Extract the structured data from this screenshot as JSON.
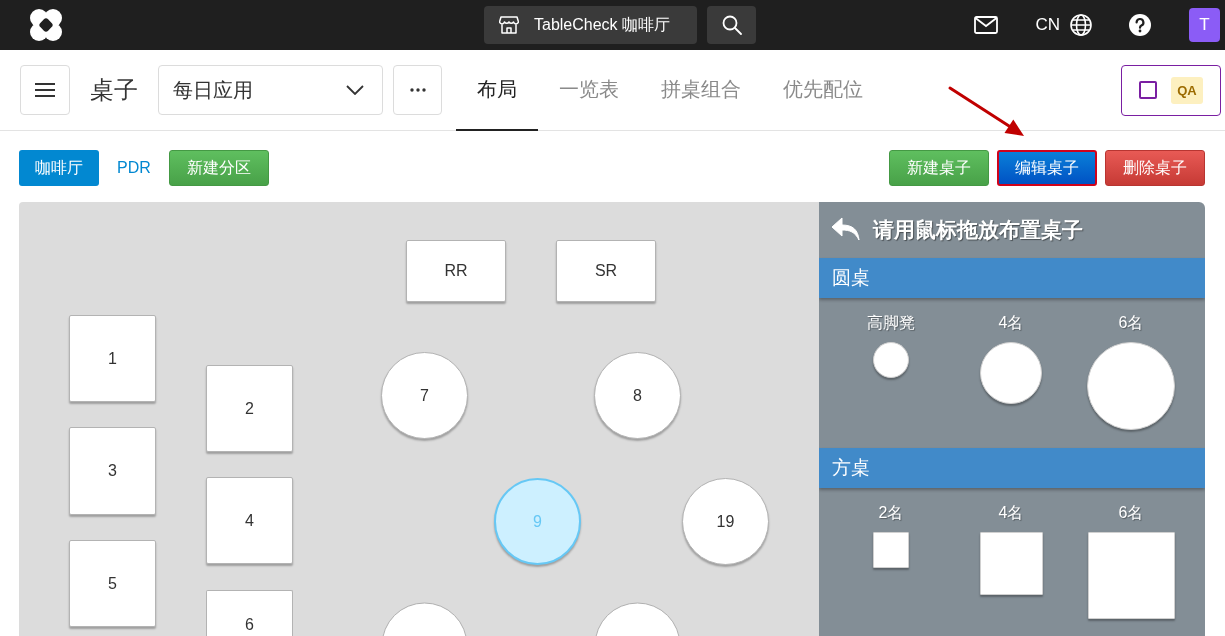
{
  "top_bar": {
    "store_button": "TableCheck 咖啡厅",
    "language": "CN",
    "avatar": "T"
  },
  "header": {
    "title": "桌子",
    "view_select": "每日应用",
    "tabs": [
      {
        "label": "布局",
        "selected": true
      },
      {
        "label": "一览表",
        "selected": false
      },
      {
        "label": "拼桌组合",
        "selected": false
      },
      {
        "label": "优先配位",
        "selected": false
      }
    ],
    "qa_toggle": {
      "label": "QA",
      "checked": false
    }
  },
  "toolbar": {
    "areas": [
      {
        "label": "咖啡厅",
        "selected": true
      },
      {
        "label": "PDR",
        "selected": false
      }
    ],
    "new_area_button": "新建分区",
    "actions": [
      {
        "kind": "new",
        "label": "新建桌子",
        "highlighted": false
      },
      {
        "kind": "edit",
        "label": "编辑桌子",
        "highlighted": true
      },
      {
        "kind": "delete",
        "label": "删除桌子",
        "highlighted": false
      }
    ]
  },
  "floor": {
    "tables": [
      {
        "label": "RR",
        "kind": "rect",
        "selected": false
      },
      {
        "label": "SR",
        "kind": "rect",
        "selected": false
      },
      {
        "label": "1",
        "kind": "square",
        "selected": false
      },
      {
        "label": "2",
        "kind": "square",
        "selected": false
      },
      {
        "label": "3",
        "kind": "square",
        "selected": false
      },
      {
        "label": "4",
        "kind": "square",
        "selected": false
      },
      {
        "label": "5",
        "kind": "square",
        "selected": false
      },
      {
        "label": "6",
        "kind": "square",
        "selected": false
      },
      {
        "label": "7",
        "kind": "round",
        "selected": false
      },
      {
        "label": "8",
        "kind": "round",
        "selected": false
      },
      {
        "label": "9",
        "kind": "round",
        "selected": true
      },
      {
        "label": "19",
        "kind": "round",
        "selected": false
      },
      {
        "kind": "round",
        "selected": false
      },
      {
        "kind": "round",
        "selected": false
      }
    ]
  },
  "palette": {
    "title": "请用鼠标拖放布置桌子",
    "groups": [
      {
        "name": "圆桌",
        "kind": "round",
        "items": [
          {
            "label": "高脚凳"
          },
          {
            "label": "4名"
          },
          {
            "label": "6名"
          }
        ]
      },
      {
        "name": "方桌",
        "kind": "square",
        "items": [
          {
            "label": "2名"
          },
          {
            "label": "4名"
          },
          {
            "label": "6名"
          }
        ]
      }
    ]
  }
}
